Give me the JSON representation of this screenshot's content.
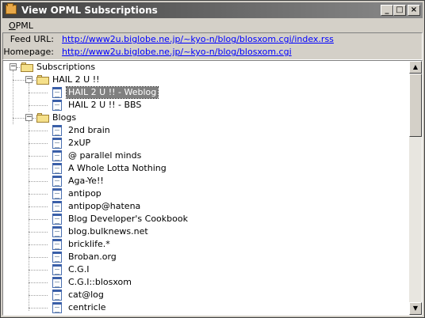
{
  "window": {
    "title": "View OPML Subscriptions",
    "minimize_glyph": "_",
    "maximize_glyph": "□",
    "close_glyph": "×"
  },
  "menu": {
    "opml_mnemonic": "O",
    "opml_rest": "PML"
  },
  "info": {
    "feed_url_label": "Feed URL:",
    "feed_url": "http://www2u.biglobe.ne.jp/~kyo-n/blog/blosxom.cgi/index.rss",
    "homepage_label": "Homepage:",
    "homepage": "http://www2u.biglobe.ne.jp/~kyo-n/blog/blosxom.cgi"
  },
  "tree": {
    "root": "Subscriptions",
    "group1": "HAIL 2 U !!",
    "group1_items": [
      "HAIL 2 U !! - Weblog",
      "HAIL 2 U !! - BBS"
    ],
    "selected_item": "HAIL 2 U !! - Weblog",
    "group2": "Blogs",
    "group2_items": [
      "2nd brain",
      "2xUP",
      "@ parallel minds",
      "A Whole Lotta Nothing",
      "Aga-Ye!!",
      "antipop",
      "antipop@hatena",
      "Blog Developer's Cookbook",
      "blog.bulknews.net",
      "bricklife.*",
      "Broban.org",
      "C.G.I",
      "C.G.I::blosxom",
      "cat@log",
      "centricle"
    ]
  },
  "scrollbar": {
    "up_glyph": "▲",
    "down_glyph": "▼"
  }
}
